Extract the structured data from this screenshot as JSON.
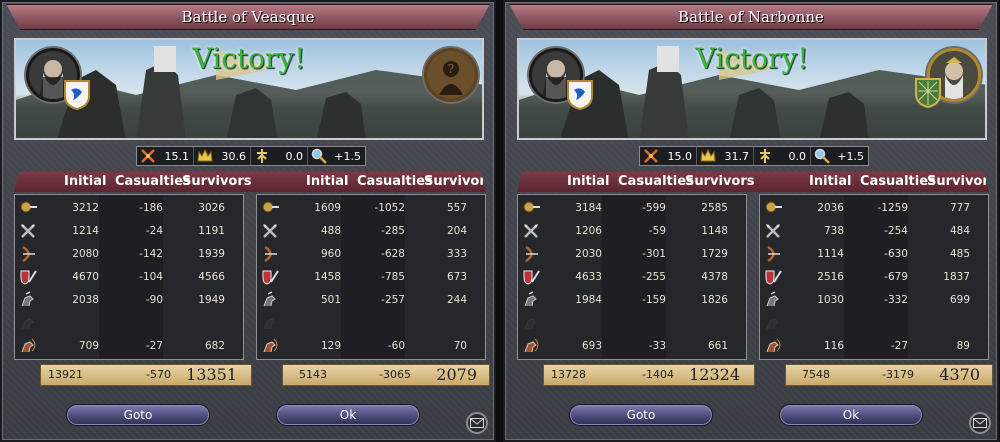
{
  "colors": {
    "victory": "#3cb43c",
    "titlebar": "#8e5660",
    "button": "#4b4c7a",
    "totals": "#d9bf86"
  },
  "stat_icons": [
    "crossed-axes-icon",
    "crown-icon",
    "terrain-icon",
    "magnifier-icon"
  ],
  "unit_icons": [
    "light-infantry-icon",
    "heavy-infantry-icon",
    "archers-icon",
    "pikemen-icon",
    "light-cavalry-icon",
    "knights-icon",
    "horse-archers-icon"
  ],
  "headers": {
    "initial": "Initial",
    "casualties": "Casualties",
    "survivors": "Survivors"
  },
  "battles": [
    {
      "title": "Battle of Veasque",
      "result": "Victory!",
      "stats": [
        "15.1",
        "30.6",
        "0.0",
        "+1.5"
      ],
      "attacker_rows": [
        [
          "3212",
          "-186",
          "3026"
        ],
        [
          "1214",
          "-24",
          "1191"
        ],
        [
          "2080",
          "-142",
          "1939"
        ],
        [
          "4670",
          "-104",
          "4566"
        ],
        [
          "2038",
          "-90",
          "1949"
        ],
        [
          "",
          "",
          ""
        ],
        [
          "709",
          "-27",
          "682"
        ]
      ],
      "defender_rows": [
        [
          "1609",
          "-1052",
          "557"
        ],
        [
          "488",
          "-285",
          "204"
        ],
        [
          "960",
          "-628",
          "333"
        ],
        [
          "1458",
          "-785",
          "673"
        ],
        [
          "501",
          "-257",
          "244"
        ],
        [
          "",
          "",
          ""
        ],
        [
          "129",
          "-60",
          "70"
        ]
      ],
      "attacker_totals": [
        "13921",
        "-570",
        "13351"
      ],
      "defender_totals": [
        "5143",
        "-3065",
        "2079"
      ],
      "goto_label": "Goto",
      "ok_label": "Ok"
    },
    {
      "title": "Battle of Narbonne",
      "result": "Victory!",
      "stats": [
        "15.0",
        "31.7",
        "0.0",
        "+1.5"
      ],
      "attacker_rows": [
        [
          "3184",
          "-599",
          "2585"
        ],
        [
          "1206",
          "-59",
          "1148"
        ],
        [
          "2030",
          "-301",
          "1729"
        ],
        [
          "4633",
          "-255",
          "4378"
        ],
        [
          "1984",
          "-159",
          "1826"
        ],
        [
          "",
          "",
          ""
        ],
        [
          "693",
          "-33",
          "661"
        ]
      ],
      "defender_rows": [
        [
          "2036",
          "-1259",
          "777"
        ],
        [
          "738",
          "-254",
          "484"
        ],
        [
          "1114",
          "-630",
          "485"
        ],
        [
          "2516",
          "-679",
          "1837"
        ],
        [
          "1030",
          "-332",
          "699"
        ],
        [
          "",
          "",
          ""
        ],
        [
          "116",
          "-27",
          "89"
        ]
      ],
      "attacker_totals": [
        "13728",
        "-1404",
        "12324"
      ],
      "defender_totals": [
        "7548",
        "-3179",
        "4370"
      ],
      "goto_label": "Goto",
      "ok_label": "Ok"
    }
  ]
}
